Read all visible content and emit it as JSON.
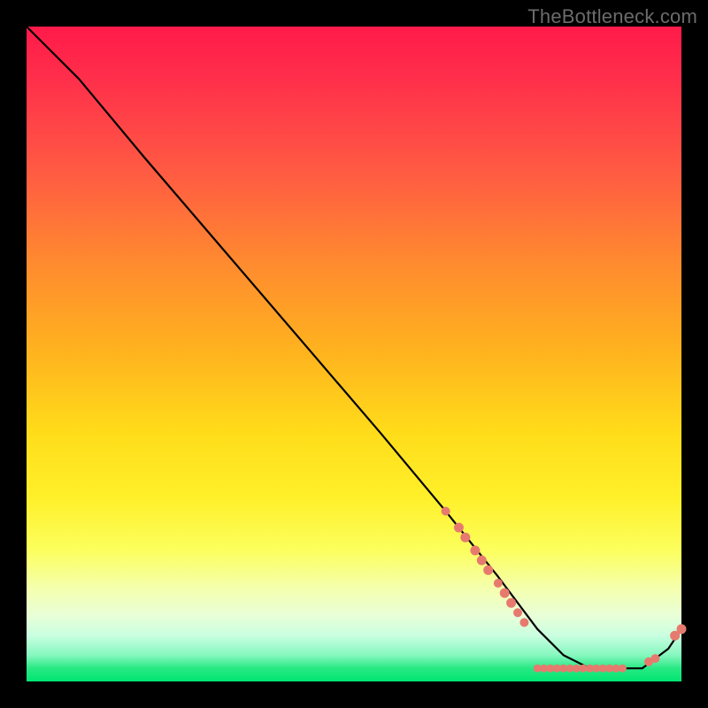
{
  "watermark": "TheBottleneck.com",
  "chart_data": {
    "type": "line",
    "title": "",
    "xlabel": "",
    "ylabel": "",
    "xlim": [
      0,
      100
    ],
    "ylim": [
      0,
      100
    ],
    "curve": {
      "name": "bottleneck-curve",
      "x": [
        0,
        8,
        18,
        30,
        42,
        54,
        64,
        72,
        78,
        82,
        86,
        90,
        94,
        98,
        100
      ],
      "y": [
        100,
        92,
        80,
        66,
        52,
        38,
        26,
        16,
        8,
        4,
        2,
        2,
        2,
        5,
        8
      ]
    },
    "markers": {
      "name": "highlight-points",
      "color": "#e77a6e",
      "points": [
        {
          "x": 64.0,
          "y": 26.0,
          "r": 1.0
        },
        {
          "x": 66.0,
          "y": 23.5,
          "r": 1.1
        },
        {
          "x": 67.0,
          "y": 22.0,
          "r": 1.1
        },
        {
          "x": 68.5,
          "y": 20.0,
          "r": 1.1
        },
        {
          "x": 69.5,
          "y": 18.5,
          "r": 1.1
        },
        {
          "x": 70.5,
          "y": 17.0,
          "r": 1.1
        },
        {
          "x": 72.0,
          "y": 15.0,
          "r": 1.0
        },
        {
          "x": 73.0,
          "y": 13.5,
          "r": 1.1
        },
        {
          "x": 74.0,
          "y": 12.0,
          "r": 1.1
        },
        {
          "x": 75.0,
          "y": 10.5,
          "r": 1.0
        },
        {
          "x": 76.0,
          "y": 9.0,
          "r": 1.0
        },
        {
          "x": 78.0,
          "y": 2.0,
          "r": 0.9
        },
        {
          "x": 79.0,
          "y": 2.0,
          "r": 0.9
        },
        {
          "x": 80.0,
          "y": 2.0,
          "r": 0.9
        },
        {
          "x": 81.0,
          "y": 2.0,
          "r": 0.9
        },
        {
          "x": 82.0,
          "y": 2.0,
          "r": 0.9
        },
        {
          "x": 83.0,
          "y": 2.0,
          "r": 0.9
        },
        {
          "x": 84.0,
          "y": 2.0,
          "r": 0.9
        },
        {
          "x": 85.0,
          "y": 2.0,
          "r": 0.9
        },
        {
          "x": 86.0,
          "y": 2.0,
          "r": 0.9
        },
        {
          "x": 87.0,
          "y": 2.0,
          "r": 0.9
        },
        {
          "x": 88.0,
          "y": 2.0,
          "r": 0.9
        },
        {
          "x": 89.0,
          "y": 2.0,
          "r": 0.9
        },
        {
          "x": 90.0,
          "y": 2.0,
          "r": 0.9
        },
        {
          "x": 91.0,
          "y": 2.0,
          "r": 0.9
        },
        {
          "x": 95.0,
          "y": 3.0,
          "r": 1.0
        },
        {
          "x": 96.0,
          "y": 3.5,
          "r": 1.0
        },
        {
          "x": 99.0,
          "y": 7.0,
          "r": 1.1
        },
        {
          "x": 100.0,
          "y": 8.0,
          "r": 1.1
        }
      ]
    }
  }
}
